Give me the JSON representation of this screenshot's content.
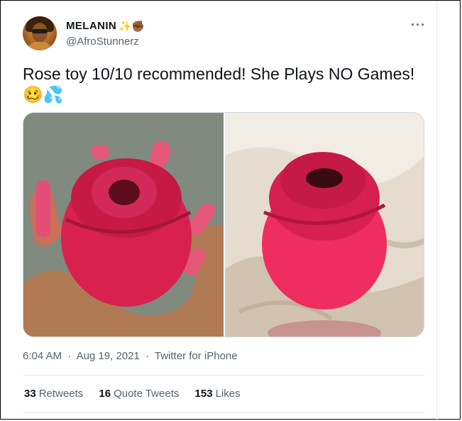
{
  "author": {
    "display_name": "MELANIN",
    "name_emojis": [
      "✨",
      "✊🏾"
    ],
    "handle": "@AfroStunnerz"
  },
  "menu": {
    "more_label": "···"
  },
  "tweet": {
    "text": "Rose toy 10/10 recommended! She Plays NO Games!",
    "emojis": "🥴💦"
  },
  "media": {
    "photos": [
      "photo-hand-holding-rose",
      "photo-rose-on-satin"
    ]
  },
  "meta": {
    "time": "6:04 AM",
    "separator": "·",
    "date": "Aug 19, 2021",
    "source": "Twitter for iPhone"
  },
  "stats": {
    "retweets_count": "33",
    "retweets_label": "Retweets",
    "quotes_count": "16",
    "quotes_label": "Quote Tweets",
    "likes_count": "153",
    "likes_label": "Likes"
  },
  "colors": {
    "text_primary": "#0f1419",
    "text_secondary": "#536471",
    "divider": "#e6ecf0",
    "rose": "#e0245e"
  }
}
